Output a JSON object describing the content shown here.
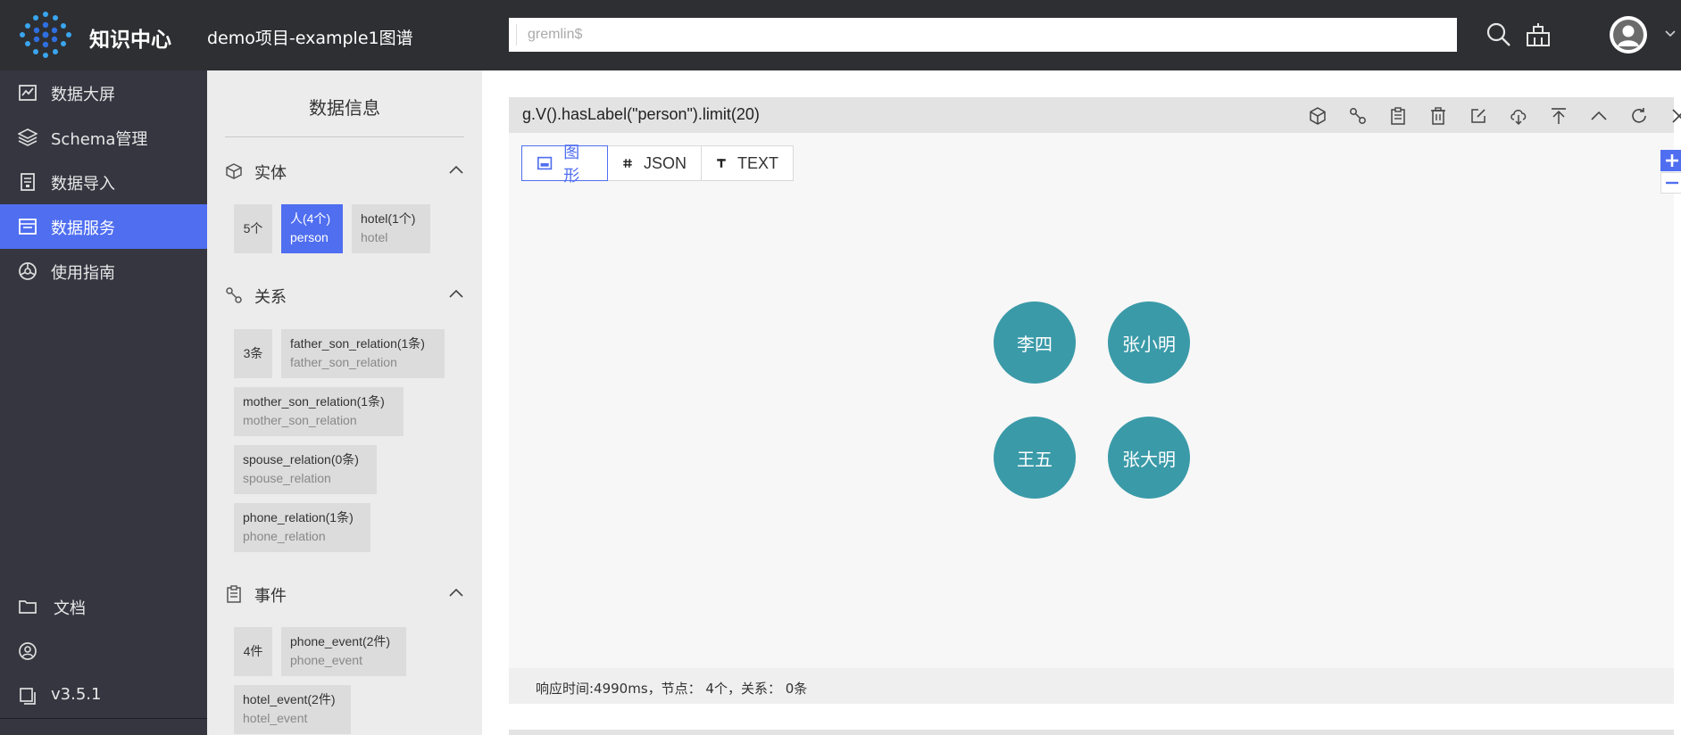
{
  "header": {
    "app_title": "知识中心",
    "project_title": "demo项目-example1图谱",
    "search_placeholder": "gremlin$"
  },
  "sidebar": {
    "items": [
      {
        "label": "数据大屏",
        "icon": "chart-icon"
      },
      {
        "label": "Schema管理",
        "icon": "layers-icon"
      },
      {
        "label": "数据导入",
        "icon": "import-icon"
      },
      {
        "label": "数据服务",
        "icon": "service-icon",
        "active": true
      },
      {
        "label": "使用指南",
        "icon": "guide-icon"
      }
    ],
    "bottom": {
      "docs_label": "文档",
      "version_label": "v3.5.1"
    }
  },
  "info_panel": {
    "title": "数据信息",
    "entity": {
      "label": "实体",
      "count": "5个",
      "tags": [
        {
          "name": "人(4个)",
          "sub": "person",
          "selected": true
        },
        {
          "name": "hotel(1个)",
          "sub": "hotel"
        }
      ]
    },
    "relation": {
      "label": "关系",
      "count": "3条",
      "tags": [
        {
          "name": "father_son_relation(1条)",
          "sub": "father_son_relation"
        },
        {
          "name": "mother_son_relation(1条)",
          "sub": "mother_son_relation"
        },
        {
          "name": "spouse_relation(0条)",
          "sub": "spouse_relation"
        },
        {
          "name": "phone_relation(1条)",
          "sub": "phone_relation"
        }
      ]
    },
    "event": {
      "label": "事件",
      "count": "4件",
      "tags": [
        {
          "name": "phone_event(2件)",
          "sub": "phone_event"
        },
        {
          "name": "hotel_event(2件)",
          "sub": "hotel_event"
        }
      ]
    }
  },
  "query": {
    "text": "g.V().hasLabel(\"person\").limit(20)",
    "tabs": [
      {
        "label": "图形",
        "active": true
      },
      {
        "label": "JSON"
      },
      {
        "label": "TEXT"
      }
    ],
    "nodes": [
      "李四",
      "张小明",
      "王五",
      "张大明"
    ],
    "status": "响应时间:4990ms，节点： 4个，关系： 0条"
  },
  "colors": {
    "accent": "#4f6ef0",
    "node": "#3a9aa8",
    "sidebar_bg": "#353640",
    "header_bg": "#2e2f33"
  }
}
